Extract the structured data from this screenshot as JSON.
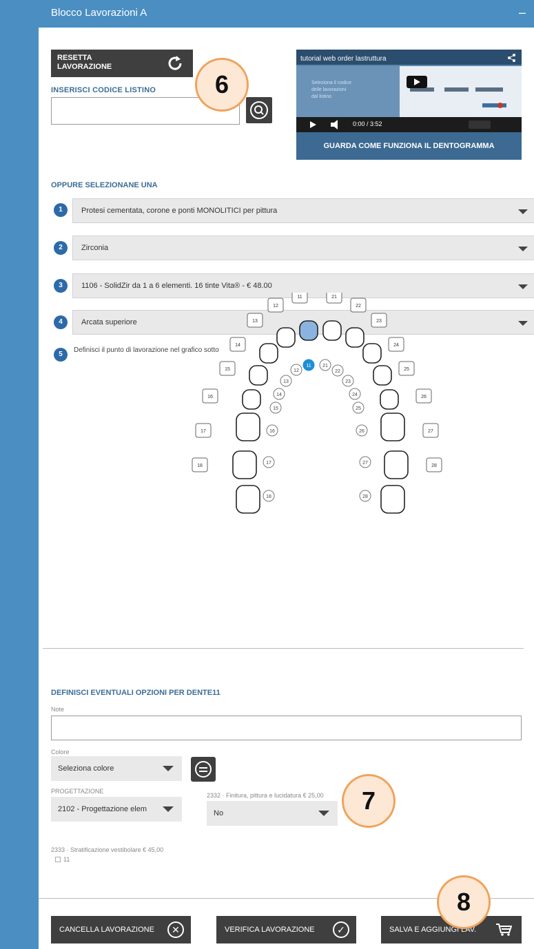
{
  "header": {
    "title": "Blocco Lavorazioni A",
    "minimize": "–"
  },
  "reset": {
    "label": "RESETTA LAVORAZIONE"
  },
  "codice": {
    "label": "INSERISCI CODICE LISTINO",
    "value": ""
  },
  "video": {
    "title": "tutorial web order lastruttura",
    "time": "0:00 / 3:52",
    "cta": "GUARDA COME FUNZIONA IL DENTOGRAMMA"
  },
  "oppure": "OPPURE SELEZIONANE UNA",
  "steps": [
    {
      "num": "1",
      "value": "Protesi cementata, corone e ponti MONOLITICI per pittura"
    },
    {
      "num": "2",
      "value": "Zirconia"
    },
    {
      "num": "3",
      "value": "1106 - SolidZir da 1 a 6 elementi. 16 tinte Vita® - € 48.00"
    },
    {
      "num": "4",
      "value": "Arcata superiore"
    },
    {
      "num": "5",
      "value": "Definisci il punto di lavorazione nel grafico sotto"
    }
  ],
  "dentogramma": {
    "upper_labels": [
      "11",
      "21",
      "12",
      "22",
      "13",
      "23",
      "14",
      "24",
      "15",
      "25",
      "16",
      "26",
      "17",
      "27",
      "18",
      "28"
    ],
    "inner_labels": [
      "11",
      "21",
      "12",
      "22",
      "13",
      "23",
      "14",
      "24",
      "15",
      "25",
      "16",
      "26",
      "17",
      "27",
      "18",
      "28"
    ],
    "selected": "11"
  },
  "opzioni": {
    "title": "DEFINISCI EVENTUALI OPZIONI PER DENTE11",
    "note_label": "Note",
    "colore_label": "Colore",
    "colore_value": "Seleziona colore",
    "progettazione_label": "PROGETTAZIONE",
    "progettazione_value": "2102 - Progettazione elem",
    "finitura_label": "2332 · Finitura, pittura e lucidatura  € 25,00",
    "finitura_value": "No",
    "stratificazione_label": "2333 · Stratificazione vestibolare  € 45,00",
    "check_label": "11"
  },
  "actions": {
    "cancella": "CANCELLA LAVORAZIONE",
    "verifica": "VERIFICA LAVORAZIONE",
    "salva": "SALVA E AGGIUNGI LAV."
  },
  "badges": {
    "b6": "6",
    "b7": "7",
    "b8": "8"
  },
  "colors": {
    "accent": "#4a8ec2",
    "dark_button": "#3f3f3f",
    "selected_tooth": "#1e8fd6",
    "badge_border": "#f0a35b"
  }
}
